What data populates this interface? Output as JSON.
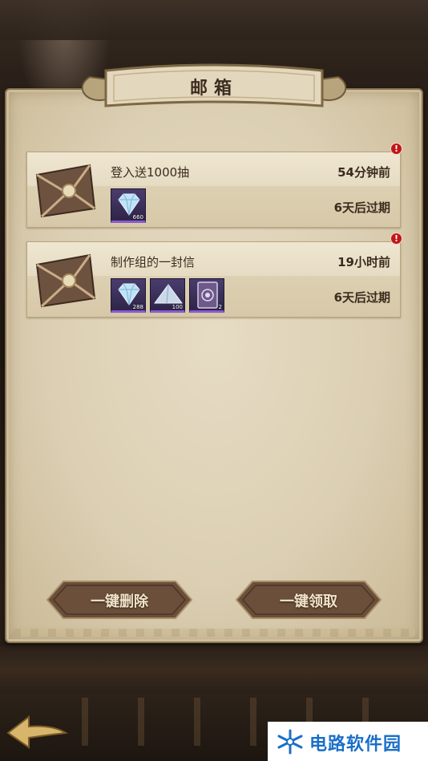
{
  "dialog": {
    "title": "邮箱"
  },
  "mails": [
    {
      "title": "登入送1000抽",
      "time": "54分钟前",
      "expire": "6天后过期",
      "unread_mark": "!",
      "attachments": [
        {
          "icon": "diamond-icon",
          "count": "660"
        }
      ]
    },
    {
      "title": "制作组的一封信",
      "time": "19小时前",
      "expire": "6天后过期",
      "unread_mark": "!",
      "attachments": [
        {
          "icon": "diamond-icon",
          "count": "288"
        },
        {
          "icon": "crystal-shard-icon",
          "count": "100"
        },
        {
          "icon": "summon-card-icon",
          "count": "2"
        }
      ]
    }
  ],
  "actions": {
    "delete_all": "一键删除",
    "claim_all": "一键领取"
  },
  "watermark": {
    "text": "电路软件园"
  },
  "colors": {
    "parchment": "#e2d6bb",
    "button": "#6b4f3a",
    "alert": "#c0161a",
    "item_rarity": "#8a5ad0",
    "watermark": "#1a6fc8"
  }
}
